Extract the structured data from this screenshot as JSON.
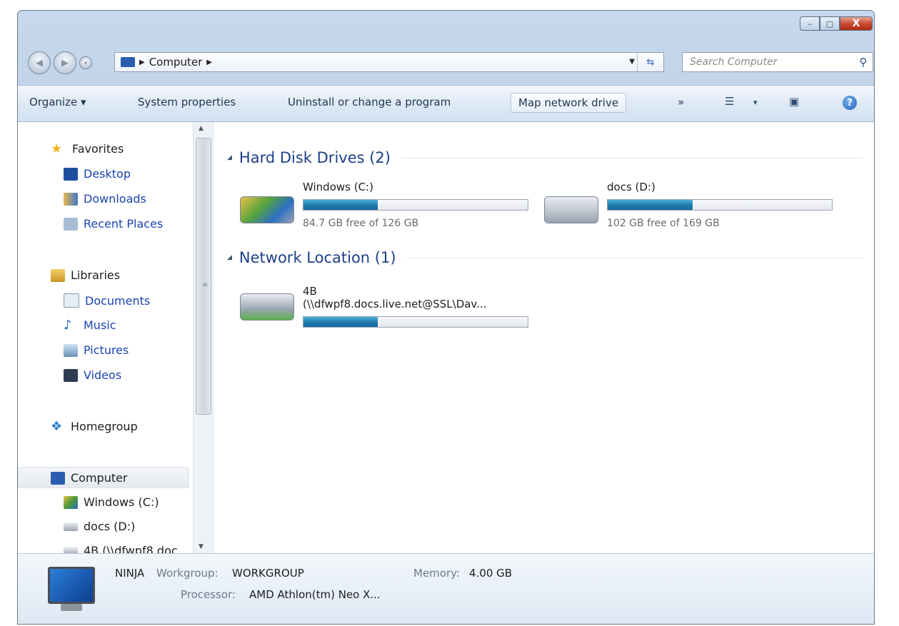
{
  "window": {
    "title_buttons": {
      "minimize": "–",
      "maximize": "▢",
      "close": "X"
    }
  },
  "address": {
    "crumbs": [
      "Computer"
    ],
    "search_placeholder": "Search Computer"
  },
  "toolbar": {
    "organize": "Organize ▾",
    "system_properties": "System properties",
    "uninstall": "Uninstall or change a program",
    "map_network": "Map network drive",
    "overflow": "»",
    "views": "▾"
  },
  "nav": {
    "favorites": "Favorites",
    "desktop": "Desktop",
    "downloads": "Downloads",
    "recent": "Recent Places",
    "libraries": "Libraries",
    "documents": "Documents",
    "music": "Music",
    "pictures": "Pictures",
    "videos": "Videos",
    "homegroup": "Homegroup",
    "computer": "Computer",
    "windows_c": "Windows (C:)",
    "docs_d": "docs (D:)",
    "net_4b": "4B (\\\\dfwpf8.doc"
  },
  "groups": {
    "hdd": "Hard Disk Drives (2)",
    "net": "Network Location (1)"
  },
  "drives": {
    "c": {
      "name": "Windows (C:)",
      "free": "84.7 GB free of 126 GB",
      "used_fraction": 0.33
    },
    "d": {
      "name": "docs (D:)",
      "free": "102 GB free of 169 GB",
      "used_fraction": 0.38
    },
    "net": {
      "name": "4B",
      "path": "(\\\\dfwpf8.docs.live.net@SSL\\Dav...",
      "used_fraction": 0.33
    }
  },
  "details": {
    "computer_name": "NINJA",
    "workgroup_label": "Workgroup:",
    "workgroup_value": "WORKGROUP",
    "memory_label": "Memory:",
    "memory_value": "4.00 GB",
    "processor_label": "Processor:",
    "processor_value": "AMD Athlon(tm) Neo X..."
  }
}
